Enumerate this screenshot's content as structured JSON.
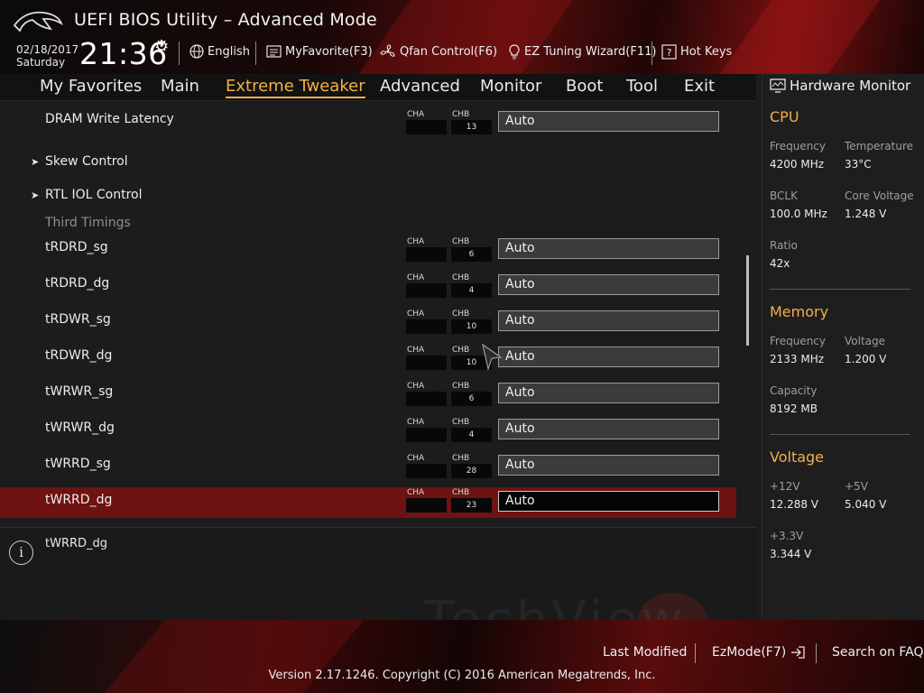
{
  "header": {
    "title": "UEFI BIOS Utility – Advanced Mode",
    "date": "02/18/2017",
    "day": "Saturday",
    "time": "21:36",
    "items": [
      {
        "label": "English",
        "icon": "globe-icon"
      },
      {
        "label": "MyFavorite(F3)",
        "icon": "favorite-list-icon"
      },
      {
        "label": "Qfan Control(F6)",
        "icon": "fan-icon"
      },
      {
        "label": "EZ Tuning Wizard(F11)",
        "icon": "lightbulb-icon"
      },
      {
        "label": "Hot Keys",
        "icon": "question-icon"
      }
    ]
  },
  "nav": {
    "tabs": [
      "My Favorites",
      "Main",
      "Extreme Tweaker",
      "Advanced",
      "Monitor",
      "Boot",
      "Tool",
      "Exit"
    ],
    "active": "Extreme Tweaker"
  },
  "settings": {
    "cha_label": "CHA",
    "chb_label": "CHB",
    "rows": [
      {
        "label": "DRAM Write Latency",
        "cha": "",
        "chb": "13",
        "value": "Auto"
      },
      {
        "label": "Skew Control"
      },
      {
        "label": "RTL IOL Control"
      },
      {
        "label": "Third Timings"
      },
      {
        "label": "tRDRD_sg",
        "cha": "",
        "chb": "6",
        "value": "Auto"
      },
      {
        "label": "tRDRD_dg",
        "cha": "",
        "chb": "4",
        "value": "Auto"
      },
      {
        "label": "tRDWR_sg",
        "cha": "",
        "chb": "10",
        "value": "Auto"
      },
      {
        "label": "tRDWR_dg",
        "cha": "",
        "chb": "10",
        "value": "Auto"
      },
      {
        "label": "tWRWR_sg",
        "cha": "",
        "chb": "6",
        "value": "Auto"
      },
      {
        "label": "tWRWR_dg",
        "cha": "",
        "chb": "4",
        "value": "Auto"
      },
      {
        "label": "tWRRD_sg",
        "cha": "",
        "chb": "28",
        "value": "Auto"
      },
      {
        "label": "tWRRD_dg",
        "cha": "",
        "chb": "23",
        "value": "Auto"
      }
    ]
  },
  "help": {
    "text": "tWRRD_dg",
    "watermark": "TechView"
  },
  "hardware_monitor": {
    "title": "Hardware Monitor",
    "cpu": {
      "title": "CPU",
      "frequency_label": "Frequency",
      "frequency": "4200 MHz",
      "temperature_label": "Temperature",
      "temperature": "33°C",
      "bclk_label": "BCLK",
      "bclk": "100.0 MHz",
      "core_voltage_label": "Core Voltage",
      "core_voltage": "1.248 V",
      "ratio_label": "Ratio",
      "ratio": "42x"
    },
    "memory": {
      "title": "Memory",
      "frequency_label": "Frequency",
      "frequency": "2133 MHz",
      "voltage_label": "Voltage",
      "voltage": "1.200 V",
      "capacity_label": "Capacity",
      "capacity": "8192 MB"
    },
    "voltage": {
      "title": "Voltage",
      "v12_label": "+12V",
      "v12": "12.288 V",
      "v5_label": "+5V",
      "v5": "5.040 V",
      "v33_label": "+3.3V",
      "v33": "3.344 V"
    }
  },
  "footer": {
    "last_modified": "Last Modified",
    "ezmode": "EzMode(F7)",
    "search": "Search on FAQ",
    "version": "Version 2.17.1246. Copyright (C) 2016 American Megatrends, Inc."
  },
  "colors": {
    "accent": "#f2b04a",
    "selected_row": "#6e1212"
  }
}
